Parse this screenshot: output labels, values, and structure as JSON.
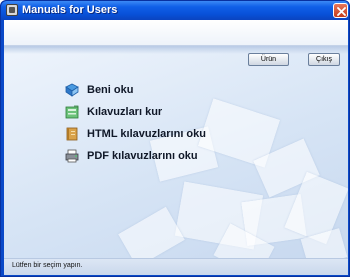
{
  "window": {
    "title": "Manuals for Users"
  },
  "toolbar": {
    "product_label": "Ürün",
    "exit_label": "Çıkış"
  },
  "menu": {
    "items": [
      {
        "label": "Beni oku",
        "icon": "readme-icon"
      },
      {
        "label": "Kılavuzları kur",
        "icon": "install-icon"
      },
      {
        "label": "HTML kılavuzlarını oku",
        "icon": "html-book-icon"
      },
      {
        "label": "PDF kılavuzlarını oku",
        "icon": "pdf-printer-icon"
      }
    ]
  },
  "status": {
    "text": "Lütfen bir seçim yapın."
  },
  "colors": {
    "titlebar": "#0a50d8",
    "client_background": "#dde8f6",
    "text": "#101828"
  }
}
